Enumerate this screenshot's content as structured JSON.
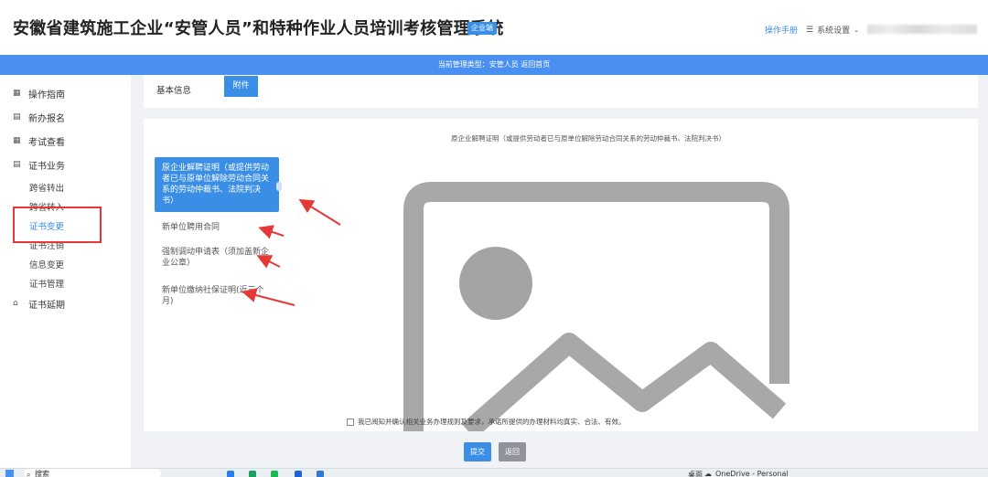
{
  "header": {
    "title": "安徽省建筑施工企业“安管人员”和特种作业人员培训考核管理系统",
    "badge": "企业端",
    "help": "操作手册",
    "settings": "系统设置"
  },
  "info_bar": "当前管理类型：安管人员  返回首页",
  "sidebar": {
    "items": [
      {
        "label": "操作指南",
        "icon": "grid-icon"
      },
      {
        "label": "新办报名",
        "icon": "file-icon"
      },
      {
        "label": "考试查看",
        "icon": "grid-icon"
      },
      {
        "label": "证书业务",
        "icon": "file-icon"
      }
    ],
    "sub_items": [
      "跨省转出",
      "跨省转入",
      "证书变更",
      "证书注销",
      "信息变更",
      "证书管理"
    ],
    "extension": {
      "label": "证书延期",
      "icon": "home-icon"
    }
  },
  "basic_info": {
    "label": "基本信息",
    "attach_button": "附件"
  },
  "preview_caption": "原企业解聘证明（或提供劳动者已与原单位解除劳动合同关系的劳动仲裁书、法院判决书）",
  "files": [
    "原企业解聘证明（或提供劳动者已与原单位解除劳动合同关系的劳动仲裁书、法院判决书）",
    "新单位聘用合同",
    "强制调动申请表（须加盖新企业公章）",
    "新单位缴纳社保证明(近三个月)"
  ],
  "agreement": "我已阅知并确认相关业务办理规则及要求，承诺所提供的办理材料均真实、合法、有效。",
  "buttons": {
    "submit": "提交",
    "back": "返回"
  },
  "taskbar": {
    "search": "搜索",
    "onedrive": "OneDrive - Personal",
    "desktop": "桌面"
  },
  "colors": {
    "accent": "#3a8ee6",
    "info_bar": "#4a90f0",
    "annotation": "#e53935"
  }
}
